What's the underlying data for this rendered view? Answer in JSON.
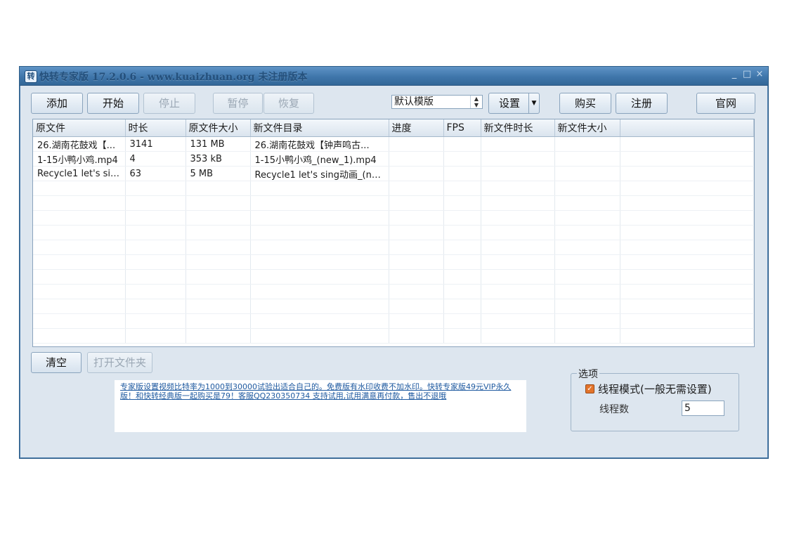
{
  "window": {
    "icon_glyph": "转",
    "title": "快转专家版 17.2.0.6 - www.kuaizhuan.org 未注册版本",
    "controls": {
      "minimize": "_",
      "maximize": "□",
      "close": "×"
    }
  },
  "toolbar": {
    "add": "添加",
    "start": "开始",
    "stop": "停止",
    "pause": "暂停",
    "resume": "恢复",
    "template_select": "默认模版",
    "settings": "设置",
    "buy": "购买",
    "register": "注册",
    "website": "官网"
  },
  "table": {
    "columns": [
      "原文件",
      "时长",
      "原文件大小",
      "新文件目录",
      "进度",
      "FPS",
      "新文件时长",
      "新文件大小",
      ""
    ],
    "rows": [
      [
        "26.湖南花鼓戏【...",
        "3141",
        "131 MB",
        "26.湖南花鼓戏【钟声鸣古...",
        "",
        "",
        "",
        "",
        ""
      ],
      [
        "1-15小鸭小鸡.mp4",
        "4",
        "353 kB",
        "1-15小鸭小鸡_(new_1).mp4",
        "",
        "",
        "",
        "",
        ""
      ],
      [
        "Recycle1 let's sing...",
        "63",
        "5 MB",
        "Recycle1 let's sing动画_(ne...",
        "",
        "",
        "",
        "",
        ""
      ]
    ]
  },
  "bottom": {
    "clear": "清空",
    "open_folder": "打开文件夹",
    "message": "专家版设置视频比特率为1000到30000试验出适合自己的。免费版有水印收费不加水印。快转专家版49元VIP永久版！和快转经典版一起购买是79！客服QQ230350734 支持试用,试用满意再付款，售出不退哦"
  },
  "options": {
    "legend": "选项",
    "thread_mode_label": "线程模式(一般无需设置)",
    "thread_mode_checked": true,
    "threads_label": "线程数",
    "threads_value": "5"
  },
  "colors": {
    "titlebar": "#3f76ab",
    "window_bg": "#dde6ef",
    "checkbox": "#e3742b",
    "link": "#1f5aa0"
  }
}
